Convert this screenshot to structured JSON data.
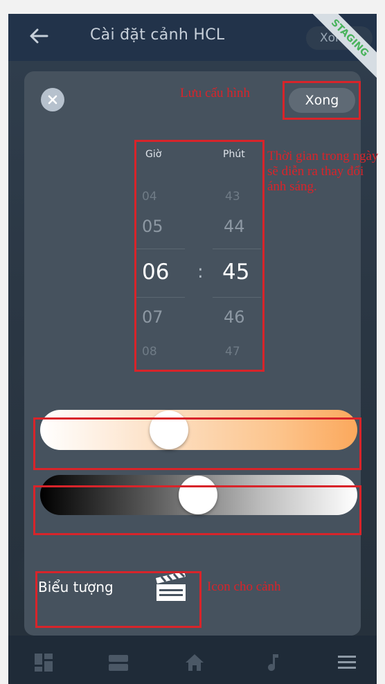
{
  "header": {
    "title": "Cài đặt cảnh HCL",
    "done_label_behind": "Xong",
    "staging_label": "STAGING"
  },
  "modal": {
    "done_label": "Xong",
    "time_picker": {
      "hour_header": "Giờ",
      "minute_header": "Phút",
      "separator": ":",
      "hours": [
        "04",
        "05",
        "06",
        "07",
        "08"
      ],
      "minutes": [
        "43",
        "44",
        "45",
        "46",
        "47"
      ],
      "selected_hour": "06",
      "selected_minute": "45"
    },
    "cct_slider": {
      "gradient_start": "#ffffff",
      "gradient_end": "#fba85c",
      "value_fraction": 0.4
    },
    "brightness_slider": {
      "gradient_start": "#000000",
      "gradient_end": "#ffffff",
      "value_fraction": 0.51
    },
    "icon_row": {
      "label": "Biểu tượng",
      "icon": "clapperboard-icon"
    }
  },
  "annotations": {
    "save_config": "Lưu cấu hình",
    "time_note": "Thời gian trong ngày sẽ diễn ra thay đổi ánh sáng.",
    "icon_note": "Icon cho cảnh",
    "color": "#d8242a"
  },
  "bottom_nav": {
    "items": [
      "dashboard-icon",
      "rooms-icon",
      "home-icon",
      "music-icon",
      "menu-icon"
    ]
  }
}
